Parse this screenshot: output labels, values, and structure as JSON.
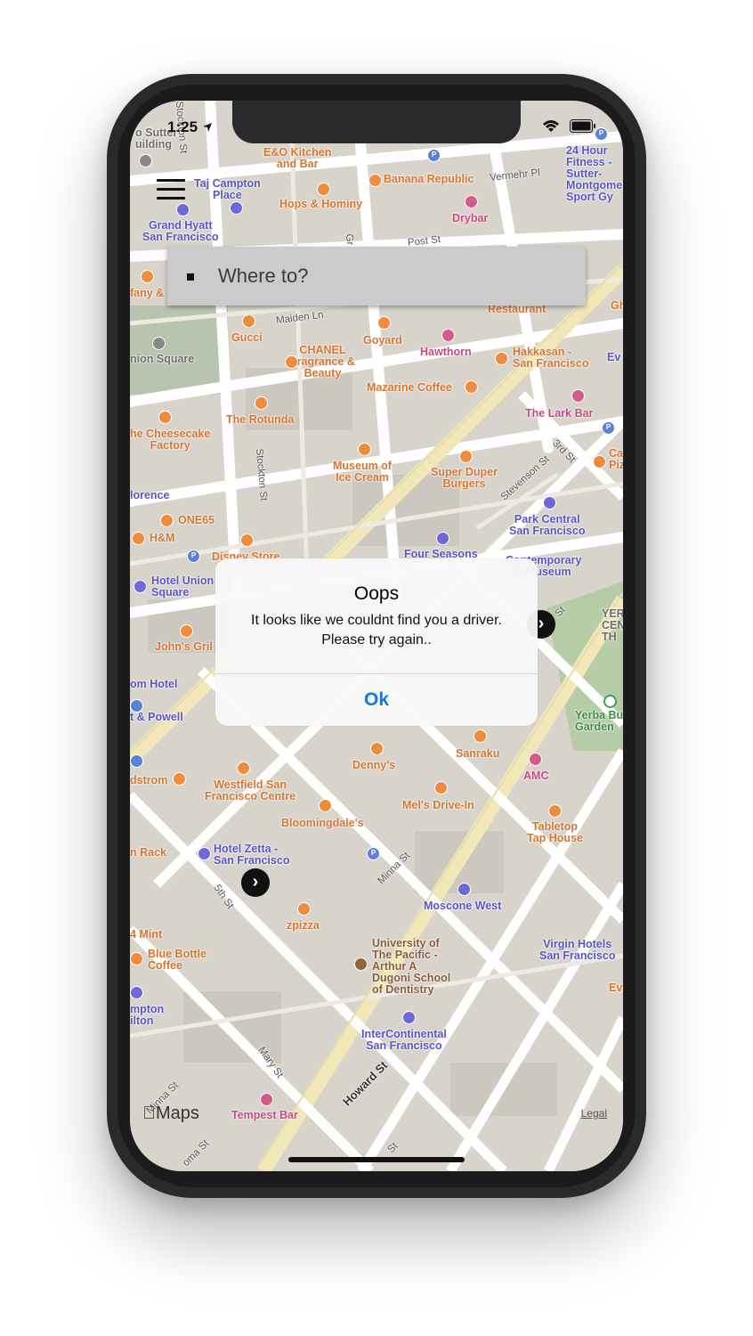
{
  "status_bar": {
    "time": "1:25"
  },
  "search": {
    "placeholder": "Where to?"
  },
  "alert": {
    "title": "Oops",
    "message": "It looks like we couldnt find you a driver. Please try again..",
    "ok_label": "Ok"
  },
  "map": {
    "attribution": "Maps",
    "legal": "Legal",
    "pois": {
      "sutter_building": "o Sutter\nuilding",
      "eo_kitchen": "E&O Kitchen\nand Bar",
      "banana_republic": "Banana Republic",
      "fitness_24": "24 Hour\nFitness -\nSutter-\nMontgome\nSport Gy",
      "taj_campton": "Taj Campton\nPlace",
      "hops_hominy": "Hops & Hominy",
      "drybar": "Drybar",
      "grand_hyatt": "Grand Hyatt\nSan Francisco",
      "tiffany": "fany &",
      "restaurant": "Restaurant",
      "gucci": "Gucci",
      "goyard": "Goyard",
      "chanel": "CHANEL\nFragrance &\nBeauty",
      "hawthorn": "Hawthorn",
      "hakkasan": "Hakkasan -\nSan Francisco",
      "union_square": "nion Square",
      "mazarine": "Mazarine Coffee",
      "lark_bar": "The Lark Bar",
      "rotunda": "The Rotunda",
      "cheesecake": "he Cheesecake\nFactory",
      "museum_ice_cream": "Museum of\nIce Cream",
      "super_duper": "Super Duper\nBurgers",
      "florence": "lorence",
      "park_central": "Park Central\nSan Francisco",
      "one65": "ONE65",
      "hm": "H&M",
      "disney": "Disney Store",
      "four_seasons": "Four Seasons",
      "contemporary": "Contemporary\nh Museum",
      "hotel_union_square": "Hotel Union\nSquare",
      "yerba_center": "YER\nCEN\nTH",
      "johns_grill": "John's Gril",
      "om_hotel": "om Hotel",
      "powell": "t & Powell",
      "yerba_garden": "Yerba Bu\nGarden",
      "dennys": "Denny's",
      "sanraku": "Sanraku",
      "amc": "AMC",
      "nordstrom": "dstrom",
      "westfield": "Westfield San\nFrancisco Centre",
      "mels": "Mel's Drive-In",
      "bloomingdales": "Bloomingdale's",
      "tabletop": "Tabletop\nTap House",
      "rack": "n Rack",
      "hotel_zetta": "Hotel Zetta -\nSan Francisco",
      "moscone": "Moscone West",
      "mint": "4 Mint",
      "zpizza": "zpizza",
      "univ_pacific": "University of\nThe Pacific -\nArthur A\nDugoni School\nof Dentistry",
      "virgin_hotels": "Virgin Hotels\nSan Francisco",
      "blue_bottle": "Blue Bottle\nCoffee",
      "ev": "Ev",
      "hampton": "mpton\nilton",
      "intercontinental": "InterContinental\nSan Francisco",
      "tempest": "Tempest Bar",
      "gh": "Gh",
      "ca_pi": "Ca\nPiz",
      "ev2": "Ev"
    },
    "streets": {
      "stockton1": "Stockton St",
      "vermehr": "Vermehr Pl",
      "maiden": "Maiden Ln",
      "post": "Post St",
      "stockton2": "Stockton St",
      "third": "3rd St",
      "stevenson": "Stevenson St",
      "st_label": "St",
      "fifth": "5th St",
      "minna": "Minna St",
      "mary": "Mary St",
      "howard": "Howard St",
      "minna2": "Minna St",
      "natoma": "oma St",
      "st2": "St",
      "grant": "Gr"
    }
  }
}
